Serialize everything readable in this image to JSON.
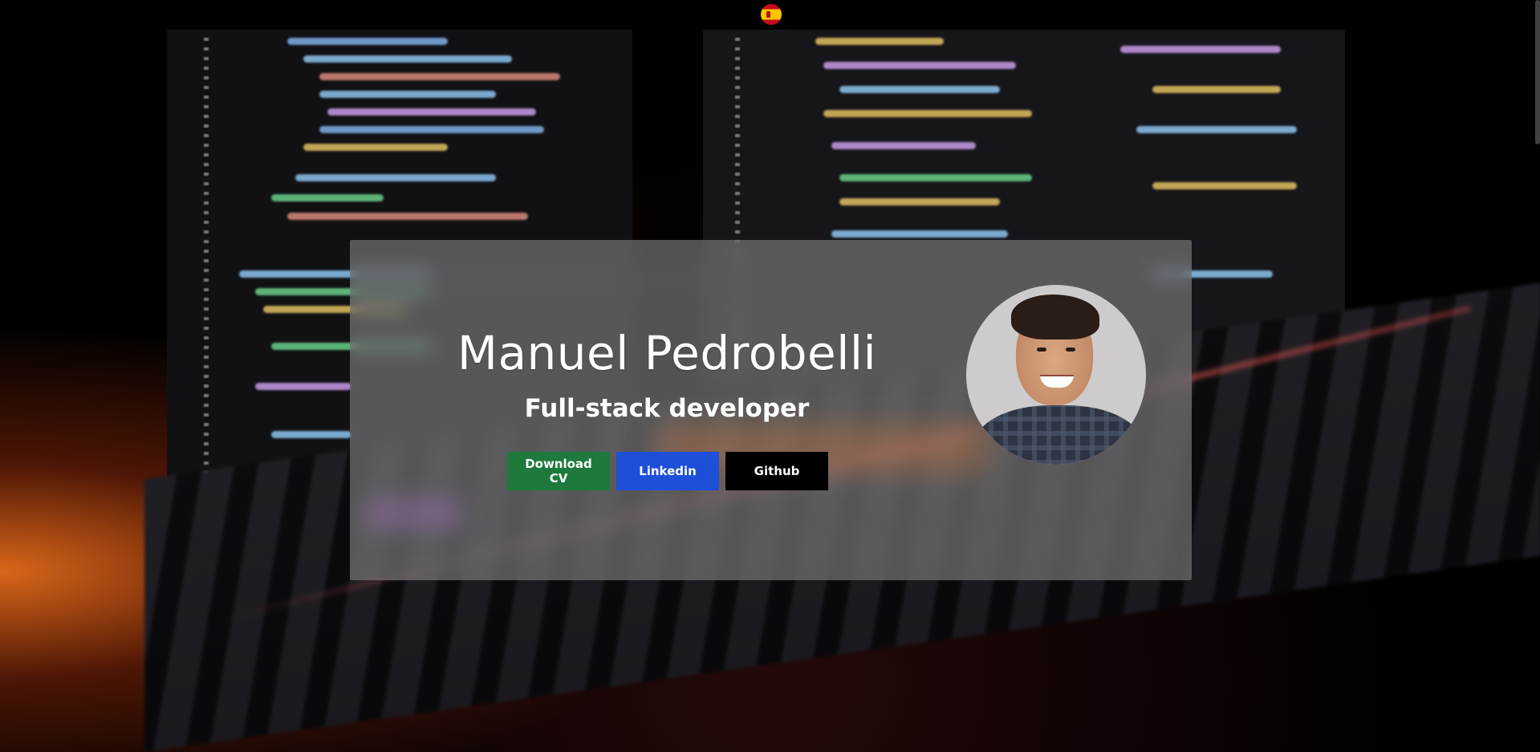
{
  "header": {
    "language_icon": "spain-flag-icon"
  },
  "hero": {
    "name": "Manuel Pedrobelli",
    "role": "Full-stack developer",
    "buttons": {
      "download_cv": "Download CV",
      "linkedin": "Linkedin",
      "github": "Github"
    },
    "avatar_icon": "profile-photo"
  },
  "colors": {
    "download_cv_bg": "#1d7a3c",
    "linkedin_bg": "#1d4fd8",
    "github_bg": "#000000",
    "card_bg": "rgba(130,130,130,0.62)"
  }
}
